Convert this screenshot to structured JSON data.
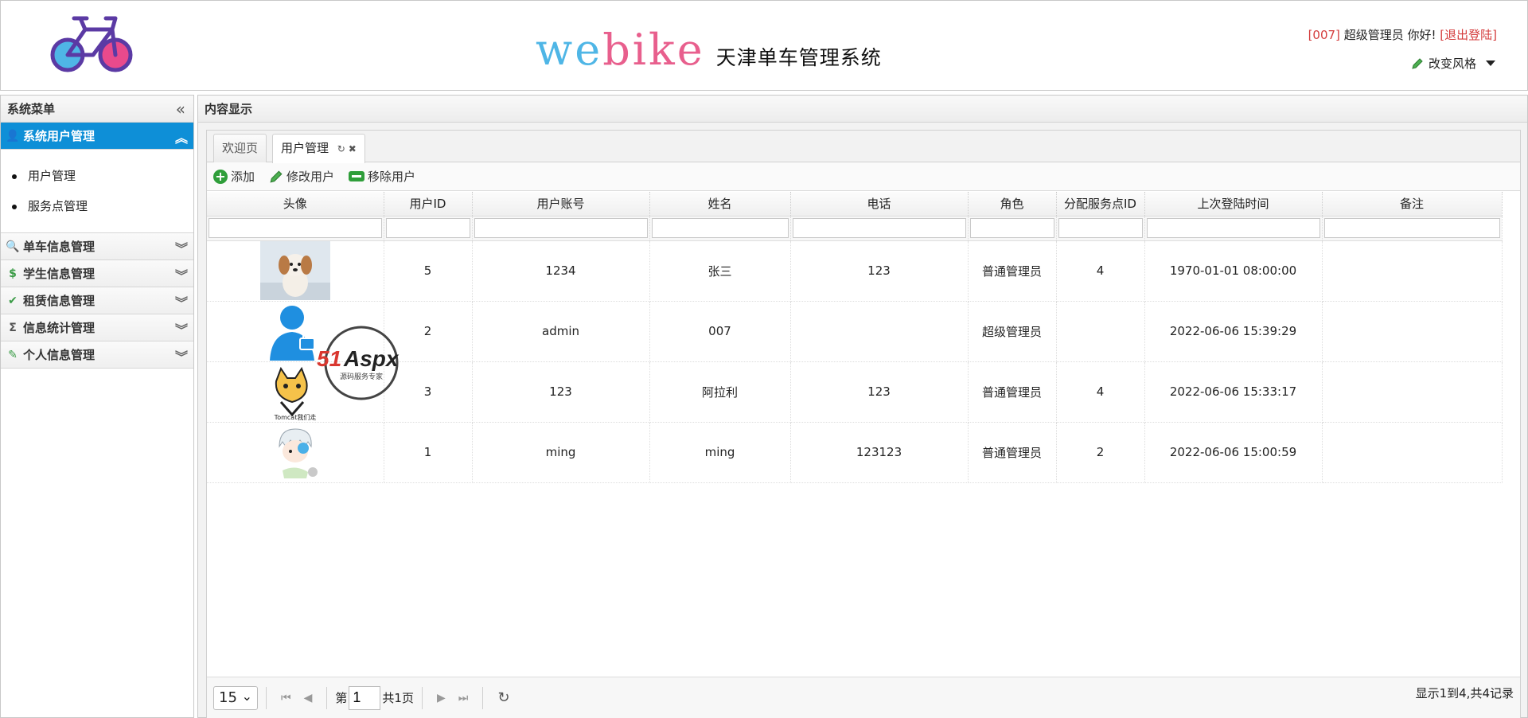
{
  "header": {
    "brand_web_w": "we",
    "brand_web_b": "bike",
    "brand_subtitle": "天津单车管理系统",
    "user_id": "[007]",
    "user_greeting": "超级管理员 你好!",
    "logout_label": "[退出登陆]",
    "theme_label": "改变风格"
  },
  "sidebar": {
    "title": "系统菜单",
    "sections": [
      {
        "label": "系统用户管理",
        "icon": "user-icon",
        "items": [
          "用户管理",
          "服务点管理"
        ]
      },
      {
        "label": "单车信息管理",
        "icon": "search-icon"
      },
      {
        "label": "学生信息管理",
        "icon": "money-icon"
      },
      {
        "label": "租赁信息管理",
        "icon": "checkmark-icon"
      },
      {
        "label": "信息统计管理",
        "icon": "sigma-icon"
      },
      {
        "label": "个人信息管理",
        "icon": "pencil-icon"
      }
    ]
  },
  "main": {
    "title": "内容显示",
    "tabs": [
      {
        "label": "欢迎页"
      },
      {
        "label": "用户管理"
      }
    ],
    "toolbar": {
      "add_label": "添加",
      "edit_label": "修改用户",
      "remove_label": "移除用户"
    },
    "columns": [
      "头像",
      "用户ID",
      "用户账号",
      "姓名",
      "电话",
      "角色",
      "分配服务点ID",
      "上次登陆时间",
      "备注"
    ],
    "rows": [
      {
        "avatar": "dog-photo",
        "id": "5",
        "account": "1234",
        "name": "张三",
        "phone": "123",
        "role": "普通管理员",
        "service_point": "4",
        "last_login": "1970-01-01 08:00:00",
        "note": ""
      },
      {
        "avatar": "user-silhouette",
        "id": "2",
        "account": "admin",
        "name": "007",
        "phone": "",
        "role": "超级管理员",
        "service_point": "",
        "last_login": "2022-06-06 15:39:29",
        "note": ""
      },
      {
        "avatar": "tomcat-cartoon",
        "id": "3",
        "account": "123",
        "name": "阿拉利",
        "phone": "123",
        "role": "普通管理员",
        "service_point": "4",
        "last_login": "2022-06-06 15:33:17",
        "note": ""
      },
      {
        "avatar": "anime-character",
        "id": "1",
        "account": "ming",
        "name": "ming",
        "phone": "123123",
        "role": "普通管理员",
        "service_point": "2",
        "last_login": "2022-06-06 15:00:59",
        "note": ""
      }
    ],
    "avatar_captions": {
      "tomcat": "Tomcat我们走"
    },
    "watermark": {
      "text": "51Aspx",
      "sub": "源码服务专家"
    },
    "pager": {
      "page_size": "15",
      "page_prefix": "第",
      "page_value": "1",
      "page_total": "共1页",
      "info": "显示1到4,共4记录"
    }
  }
}
